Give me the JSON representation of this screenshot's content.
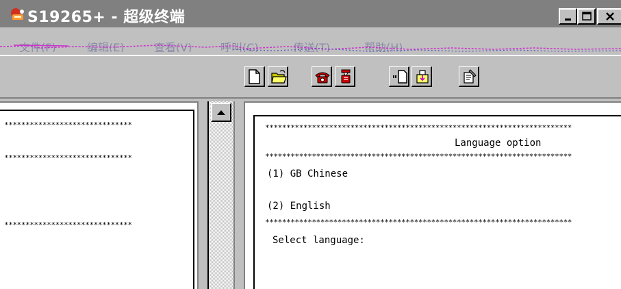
{
  "window": {
    "title": "S19265+ - 超级终端"
  },
  "menu": {
    "items": [
      "文件(F)",
      "编辑(E)",
      "查看(V)",
      "呼叫(C)",
      "传送(T)",
      "帮助(H)"
    ]
  },
  "toolbar": {
    "buttons": [
      "new",
      "open",
      "call",
      "disconnect",
      "send",
      "receive",
      "properties"
    ]
  },
  "left_pane": {
    "lines": [
      "******************************",
      "******************************",
      "******************************"
    ]
  },
  "terminal": {
    "border_top": "************************************************************************",
    "heading": "Language option",
    "border_mid": "************************************************************************",
    "option1": "(1) GB Chinese",
    "option2": "(2) English",
    "border_bottom": "************************************************************************",
    "prompt": "Select language:"
  },
  "colors": {
    "titlebar": "#808080",
    "face": "#c0c0c0",
    "terminal_bg": "#ffffff"
  }
}
